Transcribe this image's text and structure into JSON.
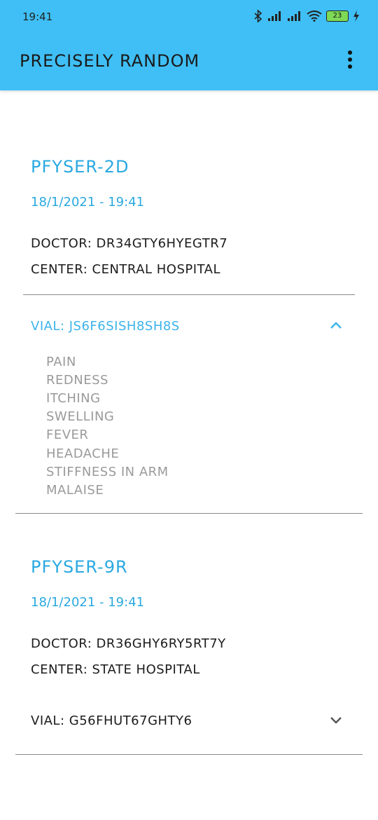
{
  "status": {
    "time": "19:41",
    "battery": "23"
  },
  "app": {
    "title": "Precisely Random"
  },
  "cards": [
    {
      "name": "PFYSEr-2D",
      "date": "18/1/2021 - 19:41",
      "doctor": "Doctor:  Dr34GTY6HYEGTr7",
      "center": "Center:  Central Hospital",
      "vial": "Vial:  JS6F6SISH8SH8S",
      "expanded": true,
      "symptoms": [
        "Pain",
        "Redness",
        "Itching",
        "Swelling",
        "Fever",
        "Headache",
        "Stiffness in Arm",
        "Malaise"
      ]
    },
    {
      "name": "PFYSEr-9R",
      "date": "18/1/2021 - 19:41",
      "doctor": "Doctor:  Dr36GHY6rY5rT7Y",
      "center": "Center:  State Hospital",
      "vial": "Vial:  G56FHUT67GHTY6",
      "expanded": false
    }
  ],
  "colors": {
    "appbar": "#3fbff5",
    "accent": "#2aa9e0",
    "symptom": "#9a9a9a"
  }
}
